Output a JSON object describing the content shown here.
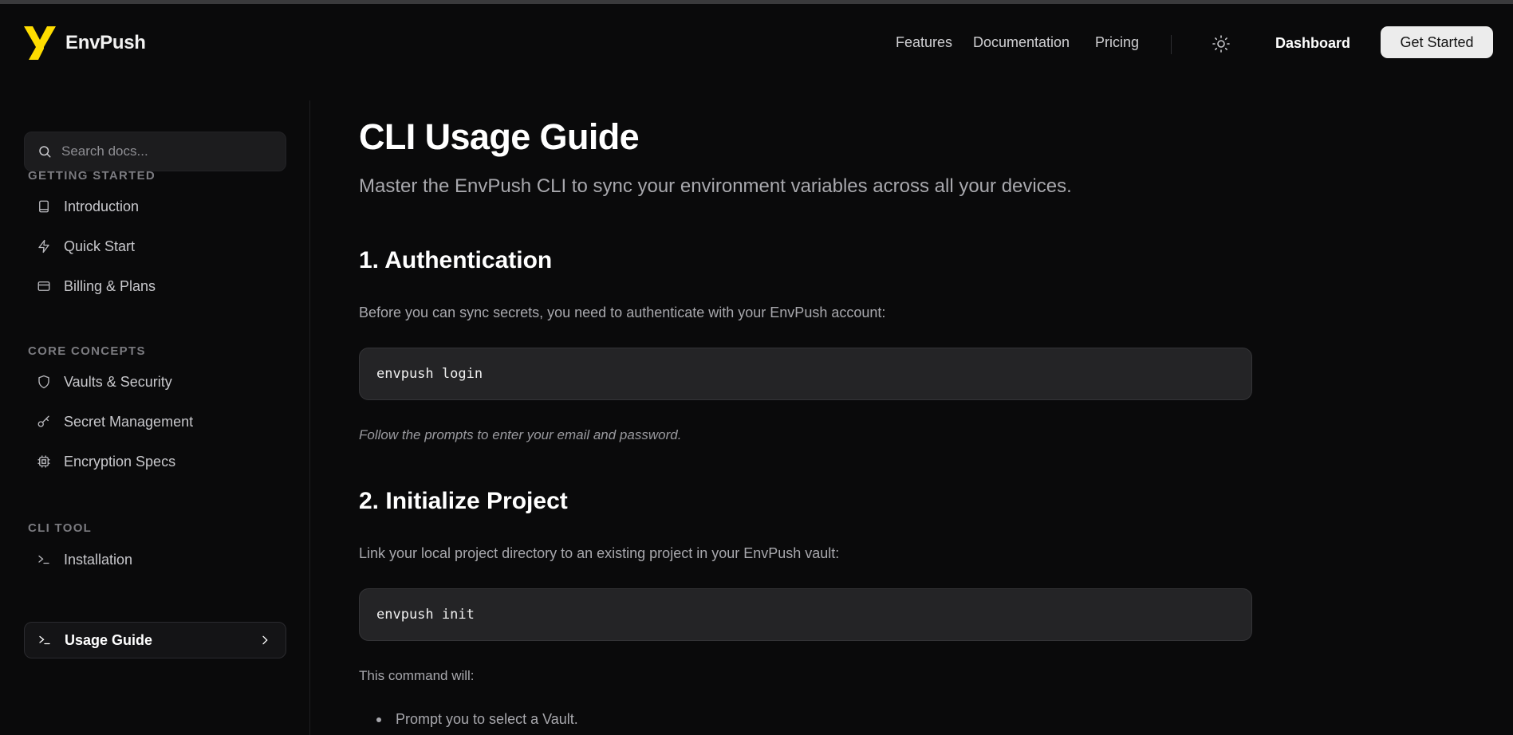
{
  "brand": {
    "name_prefix": "Env",
    "name_suffix": "Push"
  },
  "nav": {
    "features": "Features",
    "documentation": "Documentation",
    "pricing": "Pricing",
    "dashboard": "Dashboard",
    "get_started": "Get Started"
  },
  "sidebar": {
    "search_placeholder": "Search docs...",
    "sections": [
      {
        "title": "GETTING STARTED",
        "items": [
          {
            "label": "Introduction",
            "icon": "book-icon"
          },
          {
            "label": "Quick Start",
            "icon": "zap-icon"
          },
          {
            "label": "Billing & Plans",
            "icon": "credit-card-icon"
          }
        ]
      },
      {
        "title": "CORE CONCEPTS",
        "items": [
          {
            "label": "Vaults & Security",
            "icon": "shield-icon"
          },
          {
            "label": "Secret Management",
            "icon": "key-icon"
          },
          {
            "label": "Encryption Specs",
            "icon": "cpu-icon"
          }
        ]
      },
      {
        "title": "CLI TOOL",
        "items": [
          {
            "label": "Installation",
            "icon": "terminal-icon"
          },
          {
            "label": "Usage Guide",
            "icon": "terminal-icon",
            "active": true
          }
        ]
      }
    ]
  },
  "content": {
    "title": "CLI Usage Guide",
    "subtitle": "Master the EnvPush CLI to sync your environment variables across all your devices.",
    "sections": [
      {
        "heading": "1. Authentication",
        "intro": "Before you can sync secrets, you need to authenticate with your EnvPush account:",
        "code": "envpush login",
        "note": "Follow the prompts to enter your email and password."
      },
      {
        "heading": "2. Initialize Project",
        "intro": "Link your local project directory to an existing project in your EnvPush vault:",
        "code": "envpush init",
        "after": "This command will:",
        "bullets": [
          "Prompt you to select a Vault."
        ]
      }
    ]
  },
  "colors": {
    "accent": "#ffdd00",
    "background": "#0a0a0b",
    "code_bg": "#242426"
  }
}
